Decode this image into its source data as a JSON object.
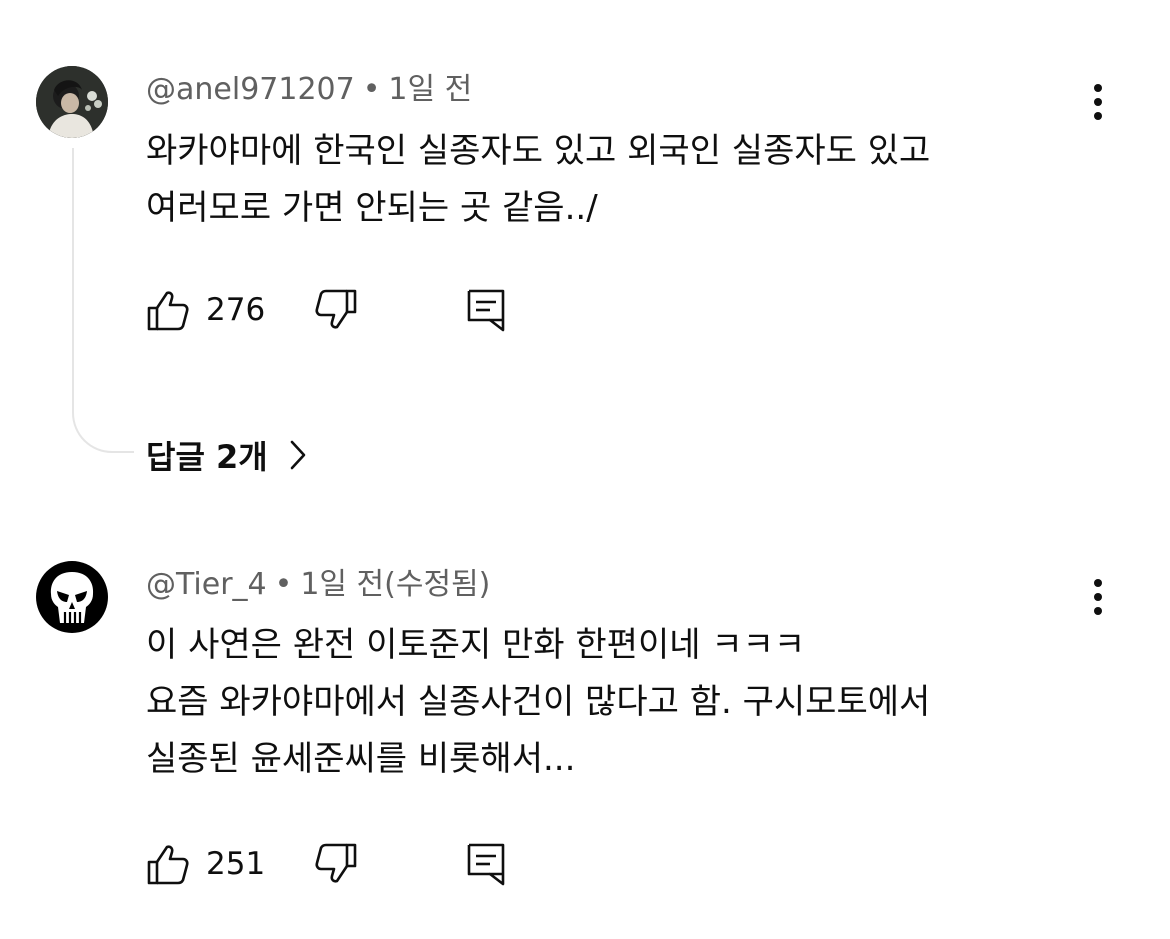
{
  "comments": [
    {
      "author": "@anel971207",
      "separator": "•",
      "time": "1일 전",
      "text_lines": [
        "와카야마에 한국인 실종자도 있고 외국인 실종자도 있고",
        "여러모로 가면 안되는 곳 같음../"
      ],
      "likes": "276",
      "avatar_icon": "photo-avatar",
      "replies_label": "답글 2개"
    },
    {
      "author": "@Tier_4",
      "separator": "•",
      "time": "1일 전(수정됨)",
      "text_lines": [
        "이 사연은 완전 이토준지 만화 한편이네 ㅋㅋㅋ",
        "요즘 와카야마에서 실종사건이 많다고 함. 구시모토에서",
        "실종된 윤세준씨를 비롯해서..."
      ],
      "likes": "251",
      "avatar_icon": "skull-avatar"
    }
  ],
  "icons": {
    "like": "thumbs-up-icon",
    "dislike": "thumbs-down-icon",
    "reply": "reply-icon",
    "more": "more-vert-icon",
    "chevron": "chevron-right-icon"
  },
  "colors": {
    "text": "#0f0f0f",
    "meta": "#606060",
    "thread_line": "#e5e5e5"
  }
}
